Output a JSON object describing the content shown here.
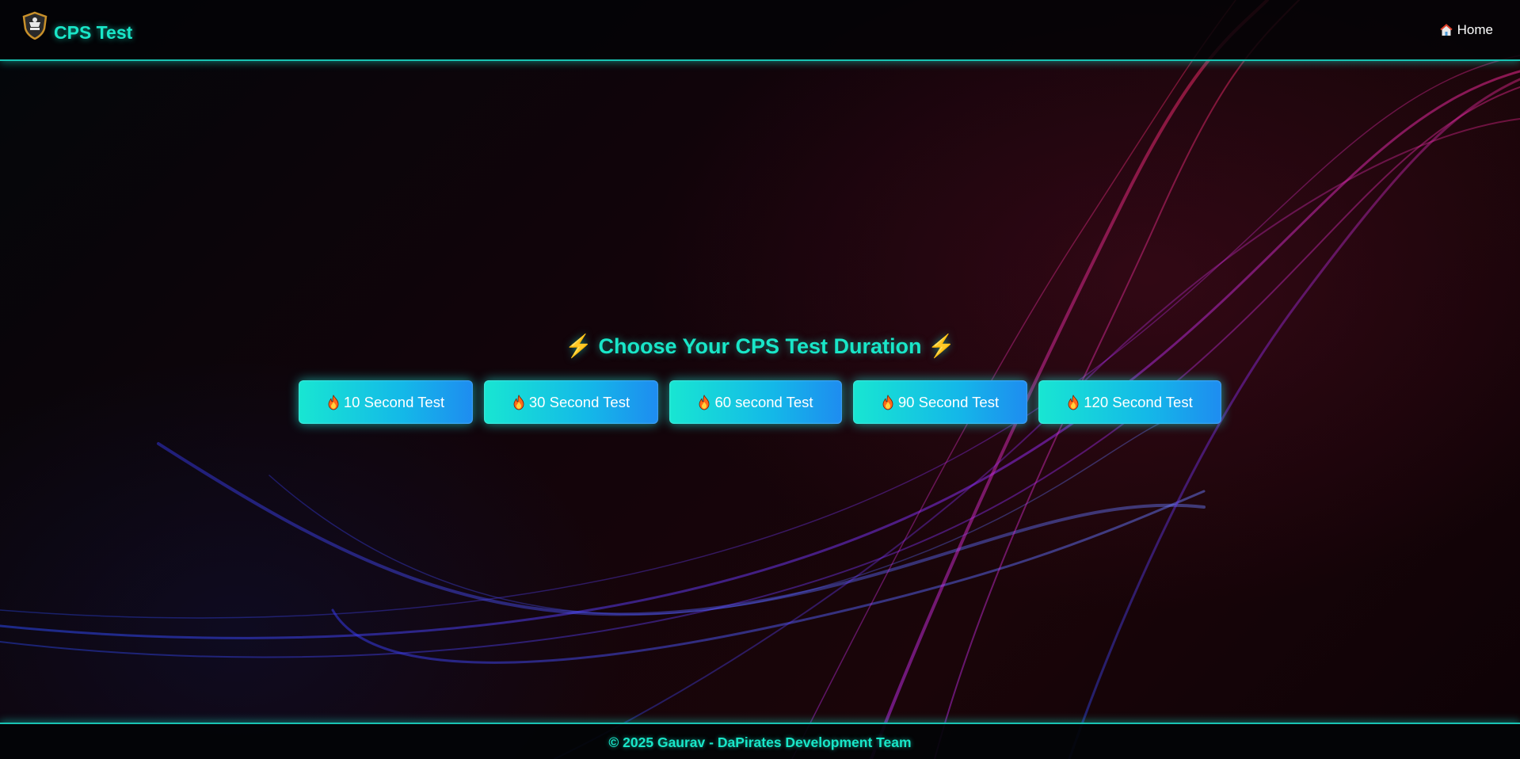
{
  "header": {
    "title": "CPS Test",
    "logo_icon": "pirate-shield-icon",
    "home_icon": "house-icon",
    "home_label": "Home"
  },
  "main": {
    "heading_prefix_icon": "⚡",
    "heading": "Choose Your CPS Test Duration",
    "heading_suffix_icon": "⚡",
    "buttons": [
      {
        "icon": "fire-icon",
        "label": "10 Second Test"
      },
      {
        "icon": "fire-icon",
        "label": "30 Second Test"
      },
      {
        "icon": "fire-icon",
        "label": "60 second Test"
      },
      {
        "icon": "fire-icon",
        "label": "90 Second Test"
      },
      {
        "icon": "fire-icon",
        "label": "120 Second Test"
      }
    ]
  },
  "footer": {
    "text": "© 2025 Gaurav - DaPirates Development Team"
  },
  "colors": {
    "accent": "#19e6c8",
    "button_start": "#18e6d2",
    "button_end": "#1e8cf0",
    "bolt": "#ffd21f",
    "background": "#0a0306"
  }
}
